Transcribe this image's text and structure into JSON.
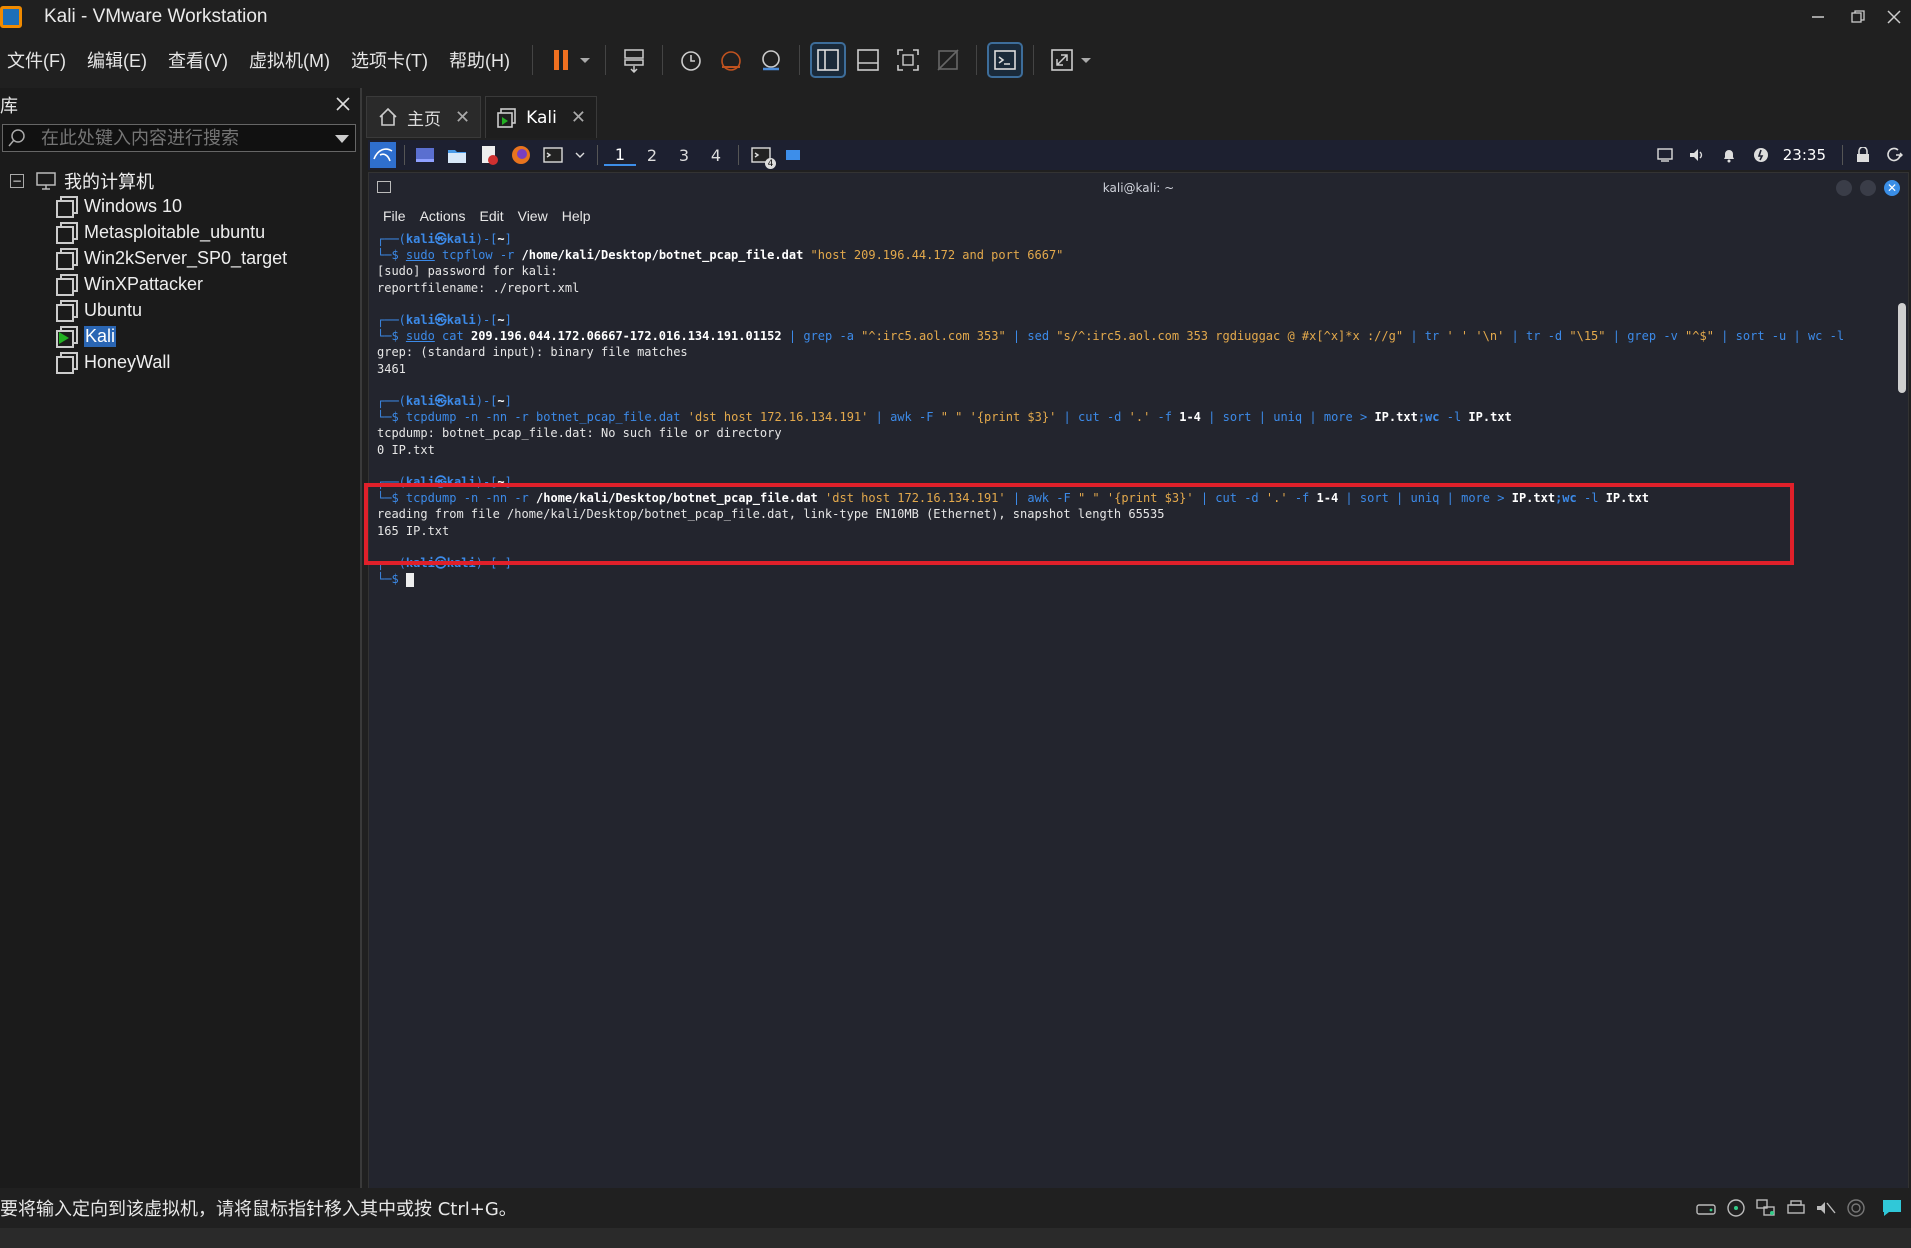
{
  "window": {
    "title": "Kali - VMware Workstation"
  },
  "menu": {
    "file": "文件(F)",
    "edit": "编辑(E)",
    "view": "查看(V)",
    "vm": "虚拟机(M)",
    "tabs": "选项卡(T)",
    "help": "帮助(H)"
  },
  "library": {
    "title": "库",
    "search_placeholder": "在此处键入内容进行搜索",
    "root_label": "我的计算机",
    "vms": [
      {
        "label": "Windows 10"
      },
      {
        "label": "Metasploitable_ubuntu"
      },
      {
        "label": "Win2kServer_SP0_target"
      },
      {
        "label": "WinXPattacker"
      },
      {
        "label": "Ubuntu"
      },
      {
        "label": "Kali",
        "selected": true,
        "running": true
      },
      {
        "label": "HoneyWall"
      }
    ]
  },
  "tabs": [
    {
      "label": "主页"
    },
    {
      "label": "Kali",
      "active": true
    }
  ],
  "kali_panel": {
    "workspaces": [
      "1",
      "2",
      "3",
      "4"
    ],
    "active_workspace": "1",
    "clock": "23:35",
    "terminal_badge": "4"
  },
  "terminal": {
    "title": "kali@kali: ~",
    "menu": [
      "File",
      "Actions",
      "Edit",
      "View",
      "Help"
    ],
    "prompt_user": "kali",
    "prompt_host": "kali",
    "prompt_dir": "~",
    "blocks": [
      {
        "cmd": "sudo tcpflow -r /home/kali/Desktop/botnet_pcap_file.dat \"host 209.196.44.172 and port 6667\"",
        "output": [
          "[sudo] password for kali:",
          "reportfilename: ./report.xml"
        ]
      },
      {
        "cmd": "sudo cat 209.196.044.172.06667-172.016.134.191.01152 | grep -a \"^:irc5.aol.com 353\" | sed \"s/^:irc5.aol.com 353 rgdiuggac @ #x[^x]*x ://g\" | tr ' ' '\\n' | tr -d \"\\15\" | grep -v \"^$\" | sort -u | wc -l",
        "output": [
          "grep: (standard input): binary file matches",
          "3461"
        ]
      },
      {
        "cmd": "tcpdump -n -nn -r botnet_pcap_file.dat 'dst host 172.16.134.191' | awk -F \" \" '{print $3}' | cut -d '.' -f 1-4 | sort | uniq | more > IP.txt;wc -l IP.txt",
        "output": [
          "tcpdump: botnet_pcap_file.dat: No such file or directory",
          "0 IP.txt"
        ]
      },
      {
        "cmd": "tcpdump -n -nn -r /home/kali/Desktop/botnet_pcap_file.dat 'dst host 172.16.134.191' | awk -F \" \" '{print $3}' | cut -d '.' -f 1-4 | sort | uniq | more > IP.txt;wc -l IP.txt",
        "output": [
          "reading from file /home/kali/Desktop/botnet_pcap_file.dat, link-type EN10MB (Ethernet), snapshot length 65535",
          "165 IP.txt"
        ]
      }
    ]
  },
  "statusbar": {
    "text": "要将输入定向到该虚拟机，请将鼠标指针移入其中或按 Ctrl+G。"
  },
  "colors": {
    "highlight_box": "#e0202a",
    "prompt_blue": "#3c8ae8",
    "string_orange": "#e3a94c",
    "selection_blue": "#2a66b4"
  }
}
